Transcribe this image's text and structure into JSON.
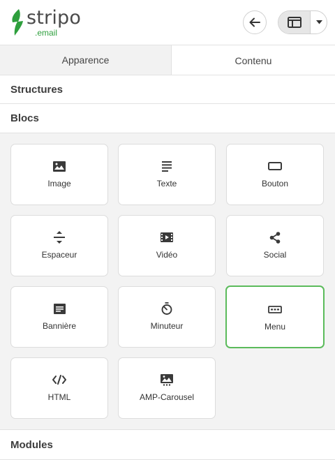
{
  "brand": {
    "name": "stripo",
    "sub": ".email",
    "color": "#2e9f3d"
  },
  "header": {
    "back_icon": "arrow-left-icon",
    "layout_icon": "panel-layout-icon",
    "dropdown_icon": "caret-down-icon"
  },
  "tabs": [
    {
      "label": "Apparence",
      "active": false
    },
    {
      "label": "Contenu",
      "active": true
    }
  ],
  "sections": {
    "structures": "Structures",
    "blocs": "Blocs",
    "modules": "Modules"
  },
  "blocks": [
    {
      "label": "Image",
      "icon": "image-icon"
    },
    {
      "label": "Texte",
      "icon": "text-lines-icon"
    },
    {
      "label": "Bouton",
      "icon": "button-icon"
    },
    {
      "label": "Espaceur",
      "icon": "spacer-icon"
    },
    {
      "label": "Vidéo",
      "icon": "video-icon"
    },
    {
      "label": "Social",
      "icon": "share-icon"
    },
    {
      "label": "Bannière",
      "icon": "banner-icon"
    },
    {
      "label": "Minuteur",
      "icon": "timer-icon"
    },
    {
      "label": "Menu",
      "icon": "menu-icon",
      "selected": true
    },
    {
      "label": "HTML",
      "icon": "code-icon"
    },
    {
      "label": "AMP-Carousel",
      "icon": "carousel-icon"
    }
  ],
  "colors": {
    "accent": "#5bbb5b",
    "panel_bg": "#f3f3f3",
    "icon": "#3a3a3a"
  }
}
